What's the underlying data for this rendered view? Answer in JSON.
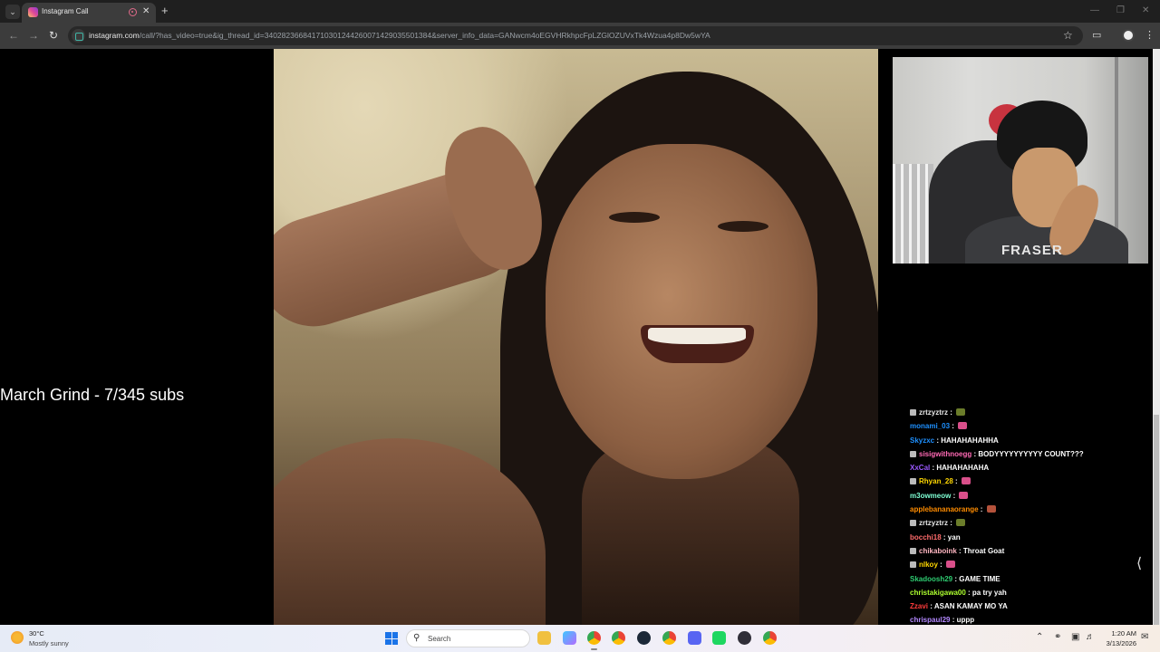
{
  "browser": {
    "tab_title": "Instagram Call",
    "url_domain": "instagram.com",
    "url_path": "/call/?has_video=true&ig_thread_id=340282366841710301244260071429035501384&server_info_data=GANwcm4oEGVHRkhpcFpLZGlOZUVxTk4Wzua4p8Dw5wYA"
  },
  "stream": {
    "overlay_text": "March Grind - 7/345 subs",
    "facecam_shirt_text": "FRASER"
  },
  "chat": [
    {
      "user": "zrtzyztrz",
      "user_color": "#e8e8e8",
      "msg": "",
      "emote": "#6b7d2a",
      "badge": true
    },
    {
      "user": "monami_03",
      "user_color": "#1e90ff",
      "msg": "",
      "emote": "#d94f8a",
      "badge": false
    },
    {
      "user": "Skyzxc",
      "user_color": "#1e90ff",
      "msg": "HAHAHAHAHHA",
      "emote": "",
      "badge": false
    },
    {
      "user": "sisigwithnoegg",
      "user_color": "#ff69b4",
      "msg": "BODYYYYYYYYYY COUNT???",
      "emote": "",
      "badge": true
    },
    {
      "user": "XxCal",
      "user_color": "#9b59ff",
      "msg": "HAHAHAHAHA",
      "emote": "",
      "badge": false
    },
    {
      "user": "Rhyan_28",
      "user_color": "#ffd700",
      "msg": "",
      "emote": "#d94f8a",
      "badge": true
    },
    {
      "user": "m3owmeow",
      "user_color": "#7fffd4",
      "msg": "",
      "emote": "#d94f8a",
      "badge": false
    },
    {
      "user": "applebananaorange",
      "user_color": "#ff8c00",
      "msg": "",
      "emote": "#b5523b",
      "badge": false
    },
    {
      "user": "zrtzyztrz",
      "user_color": "#e8e8e8",
      "msg": "",
      "emote": "#6b7d2a",
      "badge": true
    },
    {
      "user": "bocchi18",
      "user_color": "#ff6b6b",
      "msg": "yan",
      "emote": "",
      "badge": false
    },
    {
      "user": "chikaboink",
      "user_color": "#ffb6c1",
      "msg": "Throat Goat",
      "emote": "",
      "badge": true
    },
    {
      "user": "nlkoy",
      "user_color": "#ffd700",
      "msg": "",
      "emote": "#d94f8a",
      "badge": true
    },
    {
      "user": "Skadoosh29",
      "user_color": "#2ecc71",
      "msg": "GAME TIME",
      "emote": "",
      "badge": false
    },
    {
      "user": "christakigawa00",
      "user_color": "#adff2f",
      "msg": "pa try yah",
      "emote": "",
      "badge": false
    },
    {
      "user": "Zzavi",
      "user_color": "#ff3b3b",
      "msg": "ASAN KAMAY MO YA",
      "emote": "",
      "badge": false
    },
    {
      "user": "chrispaul29",
      "user_color": "#b388ff",
      "msg": "uppp",
      "emote": "",
      "badge": false
    }
  ],
  "taskbar": {
    "weather_temp": "30°C",
    "weather_desc": "Mostly sunny",
    "search_label": "Search",
    "clock_time": "1:20 AM",
    "clock_date": "3/13/2026"
  }
}
